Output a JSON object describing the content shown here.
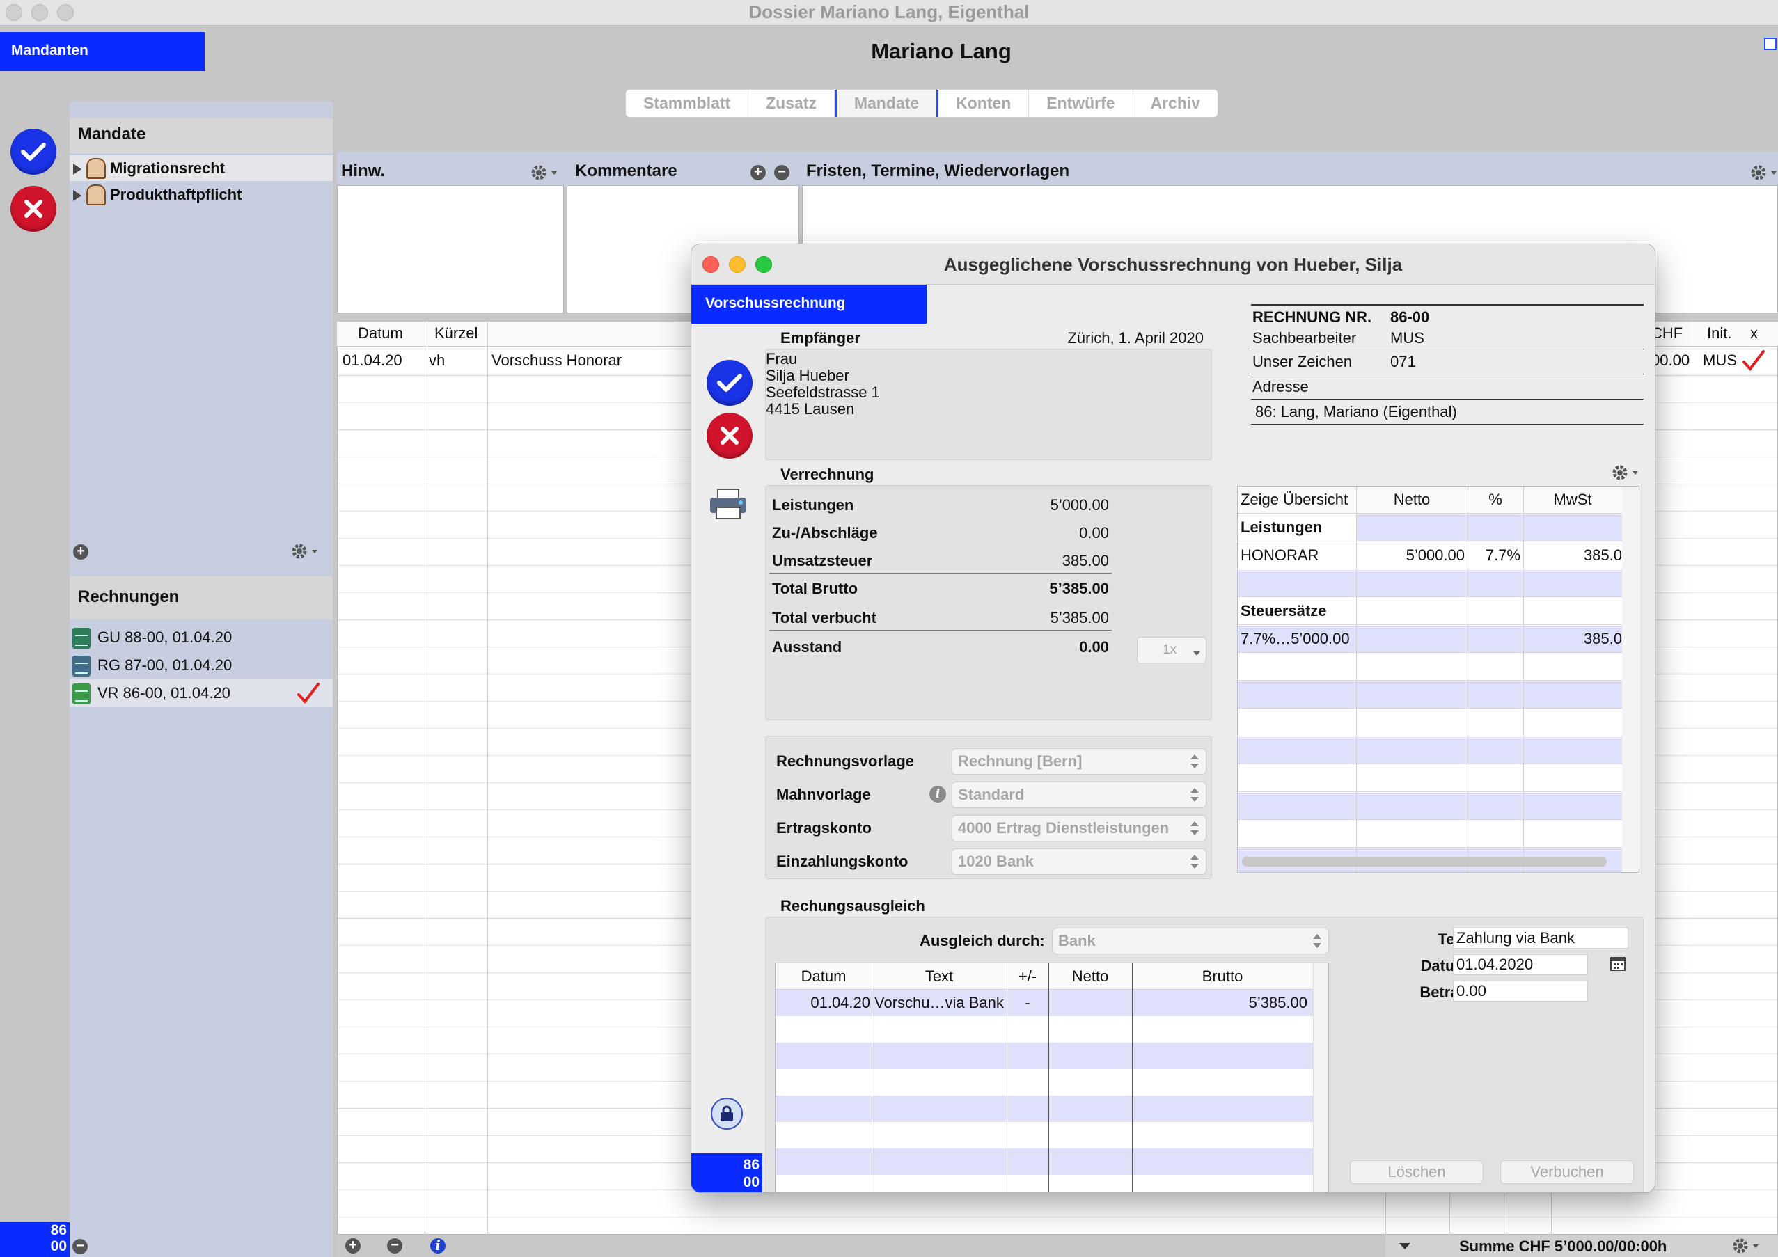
{
  "window": {
    "title": "Dossier Mariano Lang, Eigenthal"
  },
  "header": {
    "mandanten_label": "Mandanten",
    "client_name": "Mariano Lang"
  },
  "tabs": [
    {
      "label": "Stammblatt"
    },
    {
      "label": "Zusatz"
    },
    {
      "label": "Mandate",
      "active": true
    },
    {
      "label": "Konten"
    },
    {
      "label": "Entwürfe"
    },
    {
      "label": "Archiv"
    }
  ],
  "sidebar": {
    "mandate_heading": "Mandate",
    "mandate": [
      {
        "label": "Migrationsrecht",
        "selected": true
      },
      {
        "label": "Produkthaftpflicht"
      }
    ],
    "rechnungen_heading": "Rechnungen",
    "rechnungen": [
      {
        "label": "GU 88-00, 01.04.20"
      },
      {
        "label": "RG 87-00, 01.04.20"
      },
      {
        "label": "VR 86-00, 01.04.20",
        "selected": true,
        "checked": true
      }
    ],
    "badge": {
      "line1": "86",
      "line2": "00"
    }
  },
  "panels": {
    "hinweise": "Hinw.",
    "kommentare": "Kommentare",
    "fristen": "Fristen, Termine, Wiedervorlagen"
  },
  "main_table": {
    "headers": {
      "datum": "Datum",
      "kuerzel": "Kürzel",
      "chf": "CHF",
      "init": "Init.",
      "x": "x"
    },
    "rows": [
      {
        "datum": "01.04.20",
        "kuerzel": "vh",
        "text": "Vorschuss Honorar",
        "chf": "00.00",
        "init": "MUS",
        "checked": true
      }
    ]
  },
  "status_bar": {
    "summe": "Summe CHF 5’000.00/00:00h"
  },
  "dialog": {
    "title": "Ausgeglichene Vorschussrechnung von Hueber, Silja",
    "tab_label": "Vorschussrechnung",
    "empfaenger": {
      "label": "Empfänger",
      "date_line": "Zürich, 1. April 2020",
      "lines": [
        "Frau",
        "Silja Hueber",
        "Seefeldstrasse 1",
        "4415 Lausen"
      ]
    },
    "rechnung": {
      "nr_label": "RECHNUNG NR.",
      "nr_value": "86-00",
      "sachbearbeiter_label": "Sachbearbeiter",
      "sachbearbeiter_value": "MUS",
      "zeichen_label": "Unser Zeichen",
      "zeichen_value": "071",
      "adresse_label": "Adresse",
      "adresse_value": "86: Lang, Mariano (Eigenthal)"
    },
    "verrechnung": {
      "label": "Verrechnung",
      "rows": [
        {
          "label": "Leistungen",
          "value": "5’000.00"
        },
        {
          "label": "Zu-/Abschläge",
          "value": "0.00"
        },
        {
          "label": "Umsatzsteuer",
          "value": "385.00"
        },
        {
          "label": "Total Brutto",
          "value": "5’385.00",
          "bold": true
        },
        {
          "label": "Total verbucht",
          "value": "5’385.00"
        },
        {
          "label": "Ausstand",
          "value": "0.00",
          "bold": true
        }
      ],
      "copies": "1x"
    },
    "vorlagen": [
      {
        "label": "Rechnungsvorlage",
        "value": "Rechnung [Bern]"
      },
      {
        "label": "Mahnvorlage",
        "value": "Standard"
      },
      {
        "label": "Ertragskonto",
        "value": "4000 Ertrag Dienstleistungen"
      },
      {
        "label": "Einzahlungskonto",
        "value": "1020 Bank"
      }
    ],
    "overview": {
      "headers": {
        "col1": "Zeige Übersicht",
        "netto": "Netto",
        "pct": "%",
        "mwst": "MwSt"
      },
      "section1": "Leistungen",
      "row1": {
        "name": "HONORAR",
        "netto": "5’000.00",
        "pct": "7.7%",
        "mwst": "385.0"
      },
      "section2": "Steuersätze",
      "row2": {
        "name": "7.7%…5’000.00",
        "mwst": "385.0"
      }
    },
    "ausgleich": {
      "label": "Rechungsausgleich",
      "durch_label": "Ausgleich durch:",
      "durch_value": "Bank",
      "headers": {
        "datum": "Datum",
        "text": "Text",
        "pm": "+/-",
        "netto": "Netto",
        "brutto": "Brutto"
      },
      "rows": [
        {
          "datum": "01.04.20",
          "text": "Vorschu…via Bank",
          "pm": "-",
          "netto": "",
          "brutto": "5’385.00"
        }
      ],
      "text_label": "Text",
      "text_value": "Zahlung via Bank",
      "datum_label": "Datum",
      "datum_value": "01.04.2020",
      "betrag_label": "Betrag",
      "betrag_value": "0.00",
      "loeschen": "Löschen",
      "verbuchen": "Verbuchen"
    },
    "badge": {
      "line1": "86",
      "line2": "00"
    }
  },
  "colors": {
    "accent_blue": "#0a2bff",
    "ok_blue": "#1a33e6",
    "cancel_red": "#d0142c",
    "row_lavender": "#dfe0f9",
    "sidebar": "#c6cedf",
    "check_red": "#e0201f"
  }
}
